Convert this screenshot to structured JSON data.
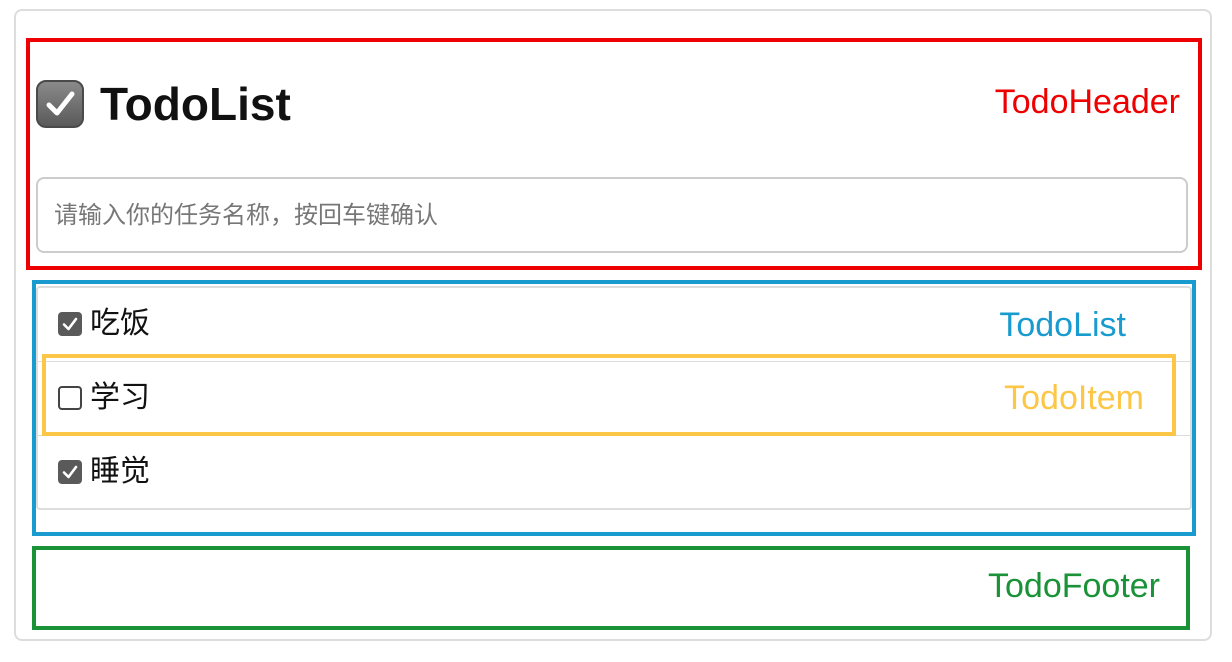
{
  "header": {
    "title": "TodoList",
    "input_placeholder": "请输入你的任务名称，按回车键确认"
  },
  "todos": [
    {
      "name": "吃饭",
      "done": true
    },
    {
      "name": "学习",
      "done": false
    },
    {
      "name": "睡觉",
      "done": true
    }
  ],
  "annotations": {
    "header": "TodoHeader",
    "list": "TodoList",
    "item": "TodoItem",
    "footer": "TodoFooter"
  },
  "colors": {
    "header": "#ee0000",
    "list": "#1a9bcf",
    "item": "#fcc647",
    "footer": "#1a9237"
  },
  "icons": {
    "app": "checkbox-icon",
    "checked": "check-icon"
  }
}
